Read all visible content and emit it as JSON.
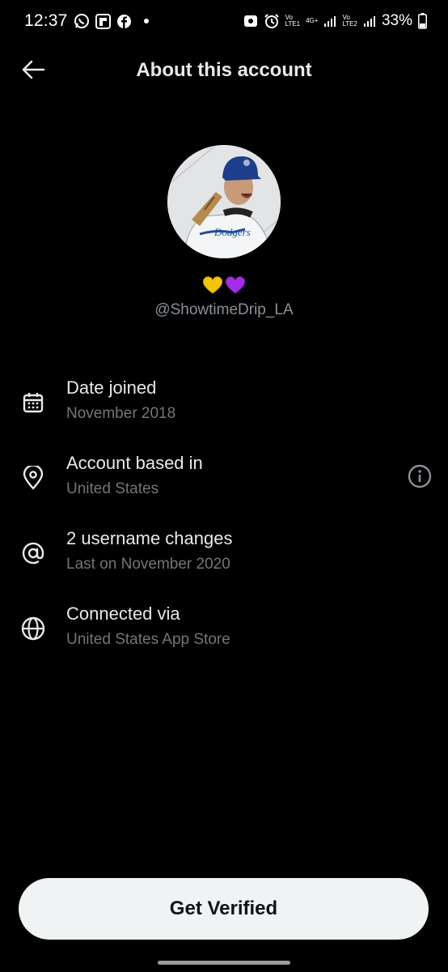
{
  "status_bar": {
    "time": "12:37",
    "battery": "33%",
    "sim1": "LTE1",
    "sim2": "LTE2",
    "network": "4G+",
    "icons": [
      "whatsapp-icon",
      "flipboard-icon",
      "facebook-icon",
      "notification-dot",
      "photo-icon",
      "alarm-icon",
      "signal-icon",
      "battery-icon"
    ]
  },
  "header": {
    "title": "About this account",
    "back_icon": "arrow-left-icon"
  },
  "profile": {
    "avatar_caption": "Dodgers",
    "emojis": [
      "💛",
      "💜"
    ],
    "handle": "@ShowtimeDrip_LA"
  },
  "details": [
    {
      "icon": "calendar-icon",
      "title": "Date joined",
      "value": "November 2018"
    },
    {
      "icon": "location-pin-icon",
      "title": "Account based in",
      "value": "United States",
      "action_icon": "info-icon"
    },
    {
      "icon": "at-sign-icon",
      "title": "2 username changes",
      "value": "Last on November 2020"
    },
    {
      "icon": "globe-icon",
      "title": "Connected via",
      "value": "United States App Store"
    }
  ],
  "footer": {
    "verify_label": "Get Verified"
  },
  "colors": {
    "background": "#000000",
    "primary_text": "#e7e9ea",
    "secondary_text": "#71767b",
    "button_bg": "#eff3f4",
    "button_text": "#0f1419"
  }
}
